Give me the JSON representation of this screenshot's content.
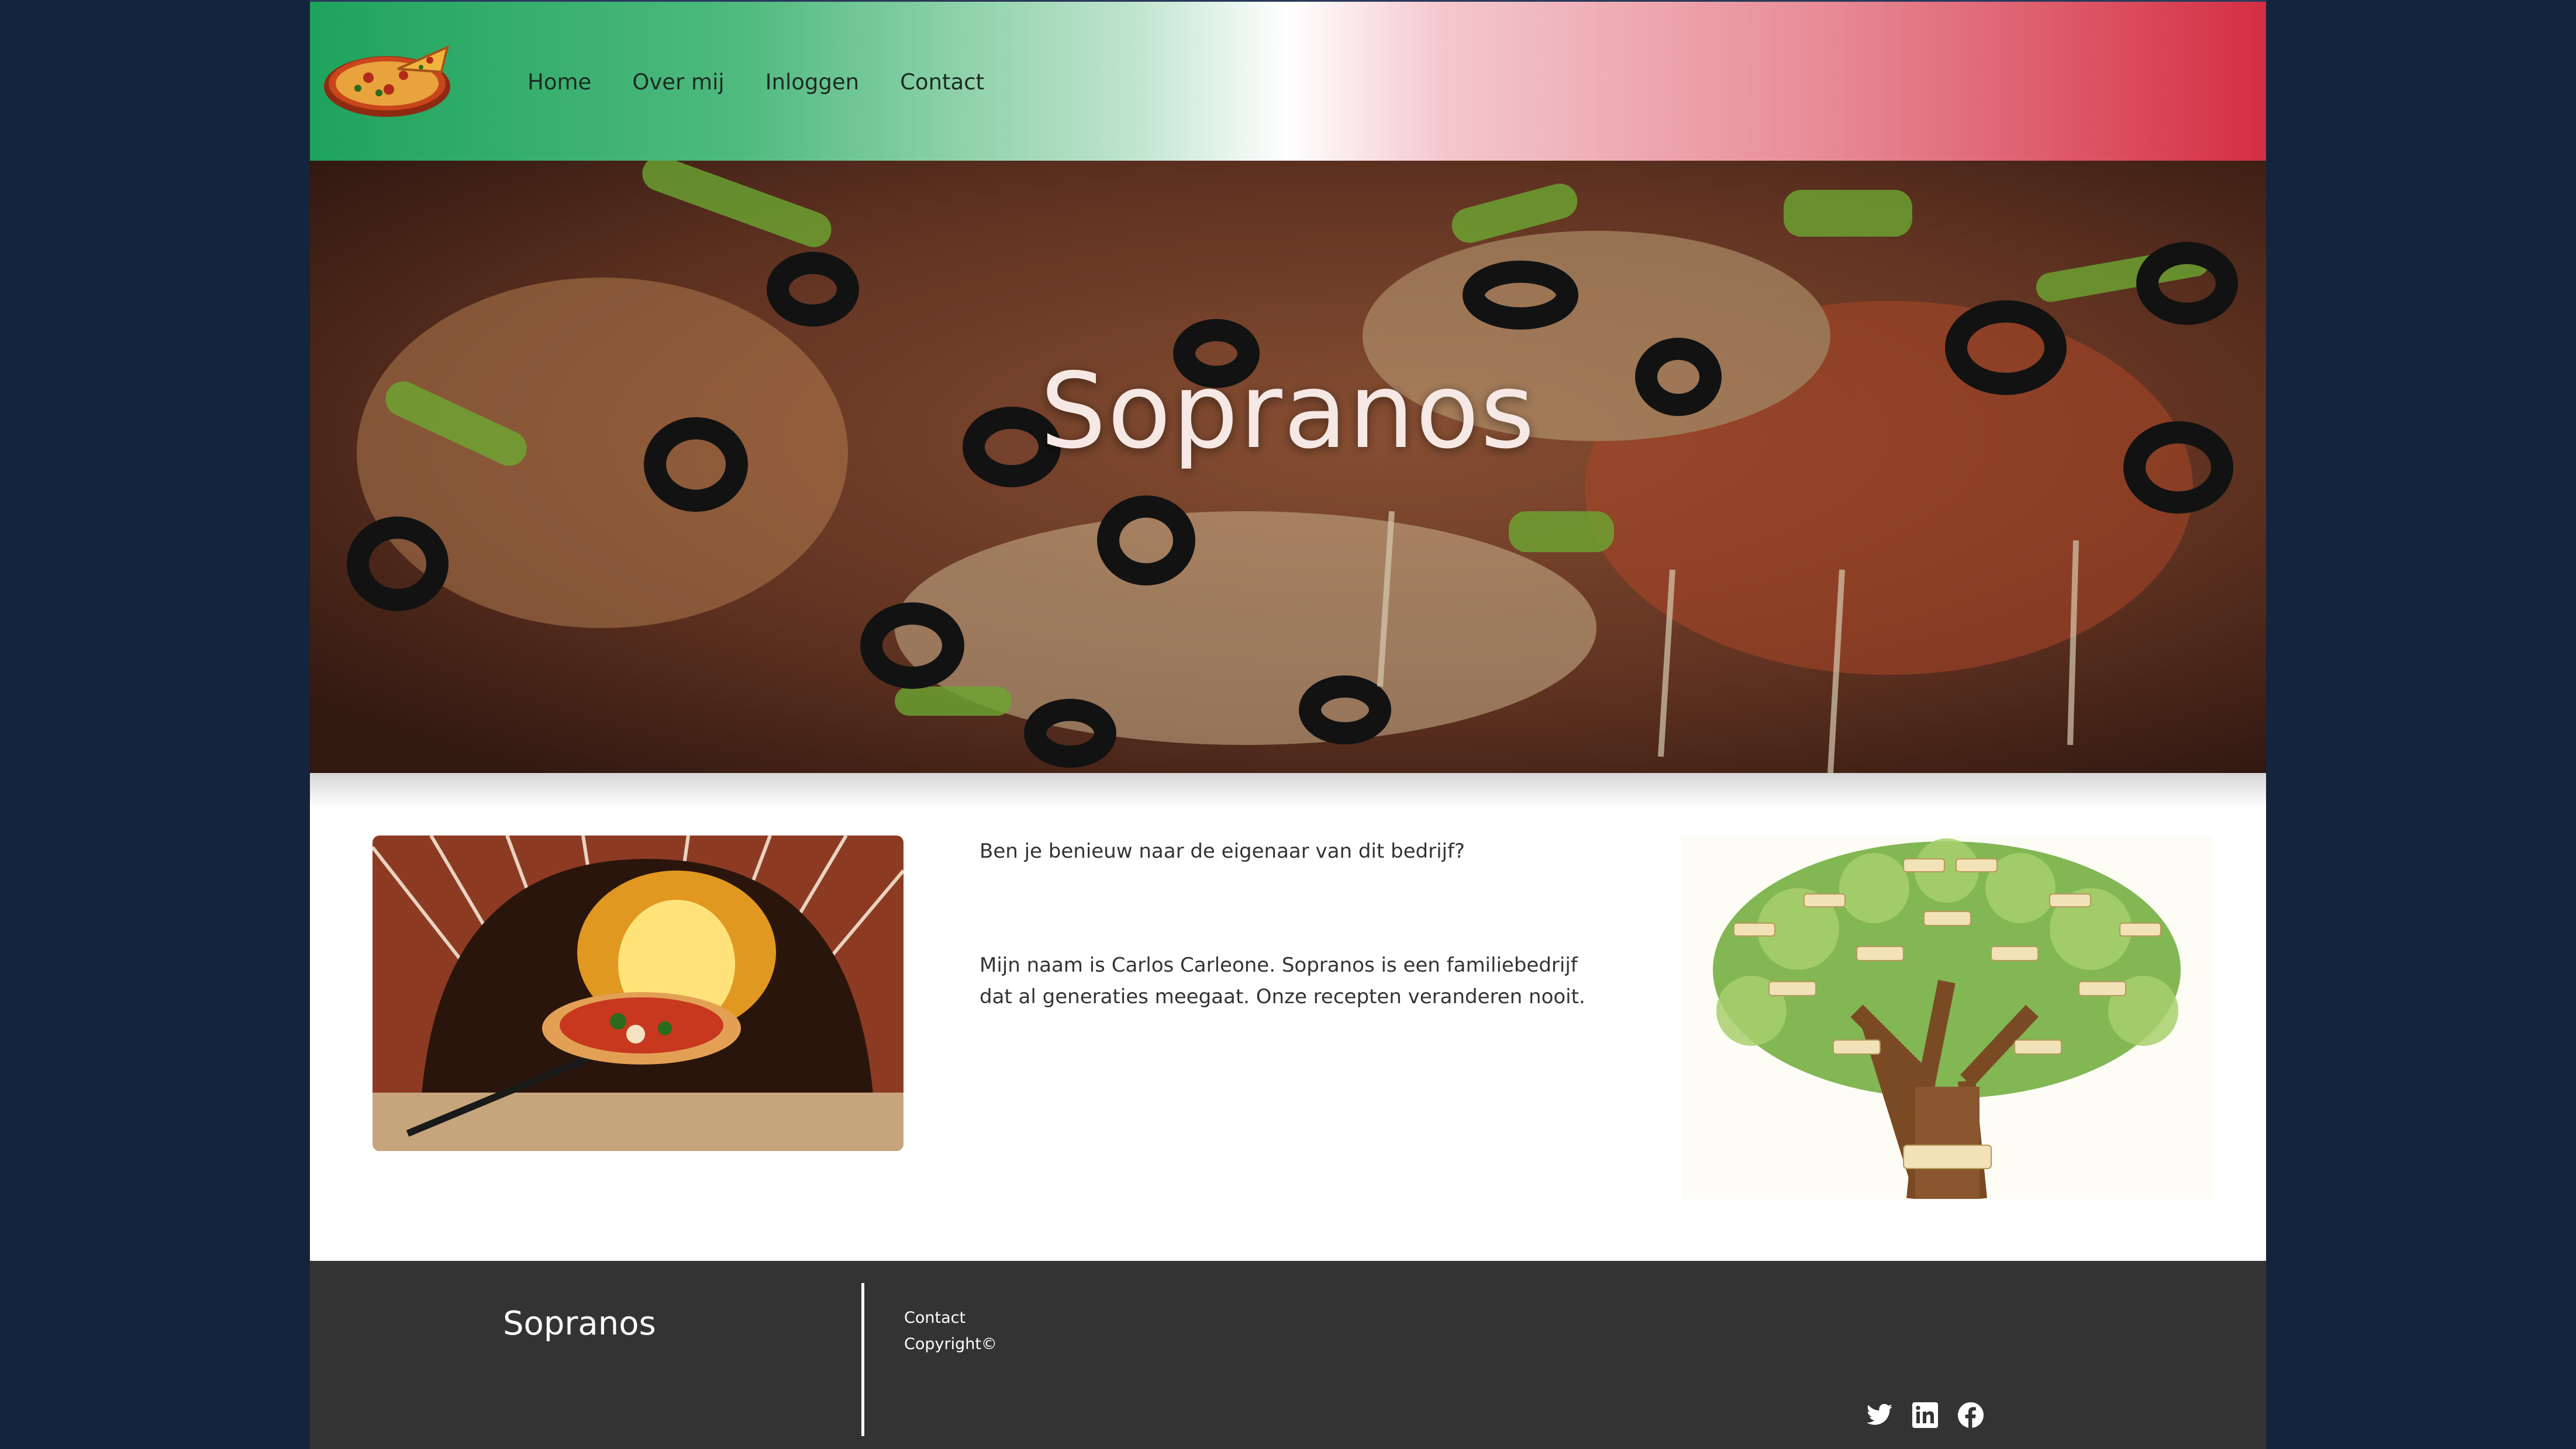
{
  "nav": {
    "items": [
      {
        "label": "Home"
      },
      {
        "label": "Over mij"
      },
      {
        "label": "Inloggen"
      },
      {
        "label": "Contact"
      }
    ]
  },
  "hero": {
    "title": "Sopranos"
  },
  "about": {
    "question": "Ben je benieuw naar de eigenaar van dit bedrijf?",
    "story": "Mijn naam is Carlos Carleone. Sopranos is een familiebedrijf dat al generaties meegaat. Onze recepten veranderen nooit."
  },
  "footer": {
    "brand": "Sopranos",
    "links": [
      {
        "label": "Contact"
      },
      {
        "label": "Copyright©"
      }
    ],
    "social_icons": [
      "twitter-icon",
      "linkedin-icon",
      "facebook-icon"
    ]
  },
  "colors": {
    "page_background": "#13243d",
    "header_green": "#1ea35c",
    "header_red": "#d42e42",
    "footer_background": "#333333"
  }
}
